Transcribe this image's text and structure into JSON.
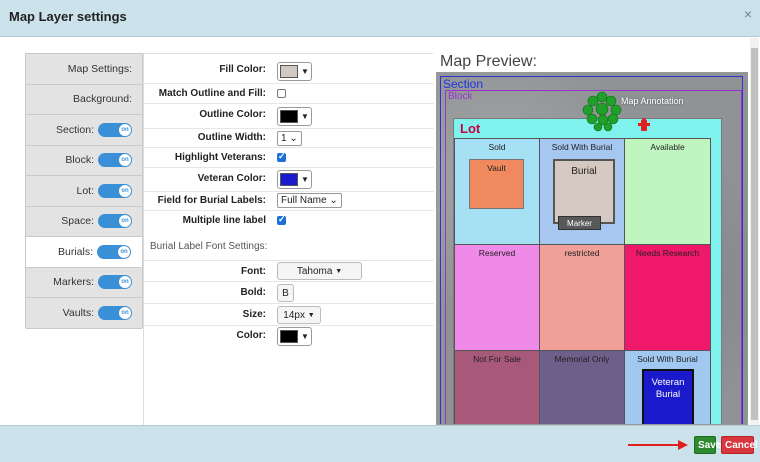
{
  "dialog": {
    "title": "Map Layer settings",
    "close_glyph": "×"
  },
  "tabs": [
    {
      "label": "Map Settings:",
      "toggle": false
    },
    {
      "label": "Background:",
      "toggle": false
    },
    {
      "label": "Section:",
      "toggle": true
    },
    {
      "label": "Block:",
      "toggle": true
    },
    {
      "label": "Lot:",
      "toggle": true
    },
    {
      "label": "Space:",
      "toggle": true
    },
    {
      "label": "Burials:",
      "toggle": true,
      "active": true
    },
    {
      "label": "Markers:",
      "toggle": true
    },
    {
      "label": "Vaults:",
      "toggle": true
    }
  ],
  "toggle_text": "on",
  "form": {
    "fill_color_label": "Fill Color:",
    "fill_color_value": "#d0c8c2",
    "match_outline_label": "Match Outline and Fill:",
    "outline_color_label": "Outline Color:",
    "outline_color_value": "#000000",
    "outline_width_label": "Outline Width:",
    "outline_width_value": "1",
    "highlight_veterans_label": "Highlight Veterans:",
    "veteran_color_label": "Veteran Color:",
    "veteran_color_value": "#1a1acc",
    "field_burial_labels_label": "Field for Burial Labels:",
    "field_burial_labels_value": "Full Name",
    "multiple_line_label": "Multiple line label",
    "font_settings_title": "Burial Label Font Settings:",
    "font_label": "Font:",
    "font_value": "Tahoma",
    "bold_label": "Bold:",
    "bold_value": "B",
    "size_label": "Size:",
    "size_value": "14px",
    "color_label": "Color:",
    "font_color_value": "#000000"
  },
  "preview": {
    "title": "Map Preview:",
    "section_label": "Section",
    "block_label": "Block",
    "lot_label": "Lot",
    "annotation": "Map Annotation",
    "cells": [
      {
        "label": "Sold",
        "color": "#a6e0f5"
      },
      {
        "label": "Sold With Burial",
        "color": "#a6c8f0"
      },
      {
        "label": "Available",
        "color": "#c0f5c0"
      },
      {
        "label": "Reserved",
        "color": "#f08ae8"
      },
      {
        "label": "restricted",
        "color": "#f0a098"
      },
      {
        "label": "Needs Research",
        "color": "#f0186a"
      },
      {
        "label": "Not For Sale",
        "color": "#a85878"
      },
      {
        "label": "Memorial Only",
        "color": "#6e5e8a"
      },
      {
        "label": "Sold With Burial",
        "color": "#a0c8f0"
      }
    ],
    "vault_label": "Vault",
    "burial_label": "Burial",
    "marker_label": "Marker",
    "veteran_label_line1": "Veteran",
    "veteran_label_line2": "Burial"
  },
  "footer": {
    "save_label": "Save",
    "cancel_label": "Cancel"
  }
}
